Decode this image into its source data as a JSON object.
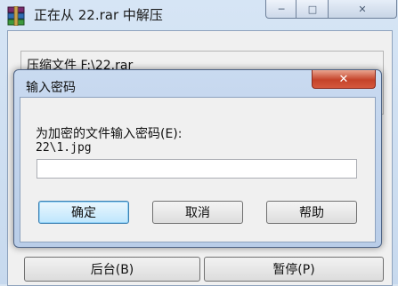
{
  "window": {
    "title": "正在从 22.rar 中解压",
    "minimize_glyph": "─",
    "maximize_glyph": "□",
    "close_glyph": "✕"
  },
  "compress_panel": {
    "label": "压缩文件 F:\\22.rar"
  },
  "bottom_buttons": {
    "background": "后台(B)",
    "pause": "暂停(P)"
  },
  "dialog": {
    "title": "输入密码",
    "close_glyph": "✕",
    "prompt": "为加密的文件输入密码(E):",
    "file_path": "22\\1.jpg",
    "password_value": "",
    "ok_label": "确定",
    "cancel_label": "取消",
    "help_label": "帮助"
  },
  "colors": {
    "accent": "#3c7fb1",
    "close_red": "#c5432a"
  }
}
